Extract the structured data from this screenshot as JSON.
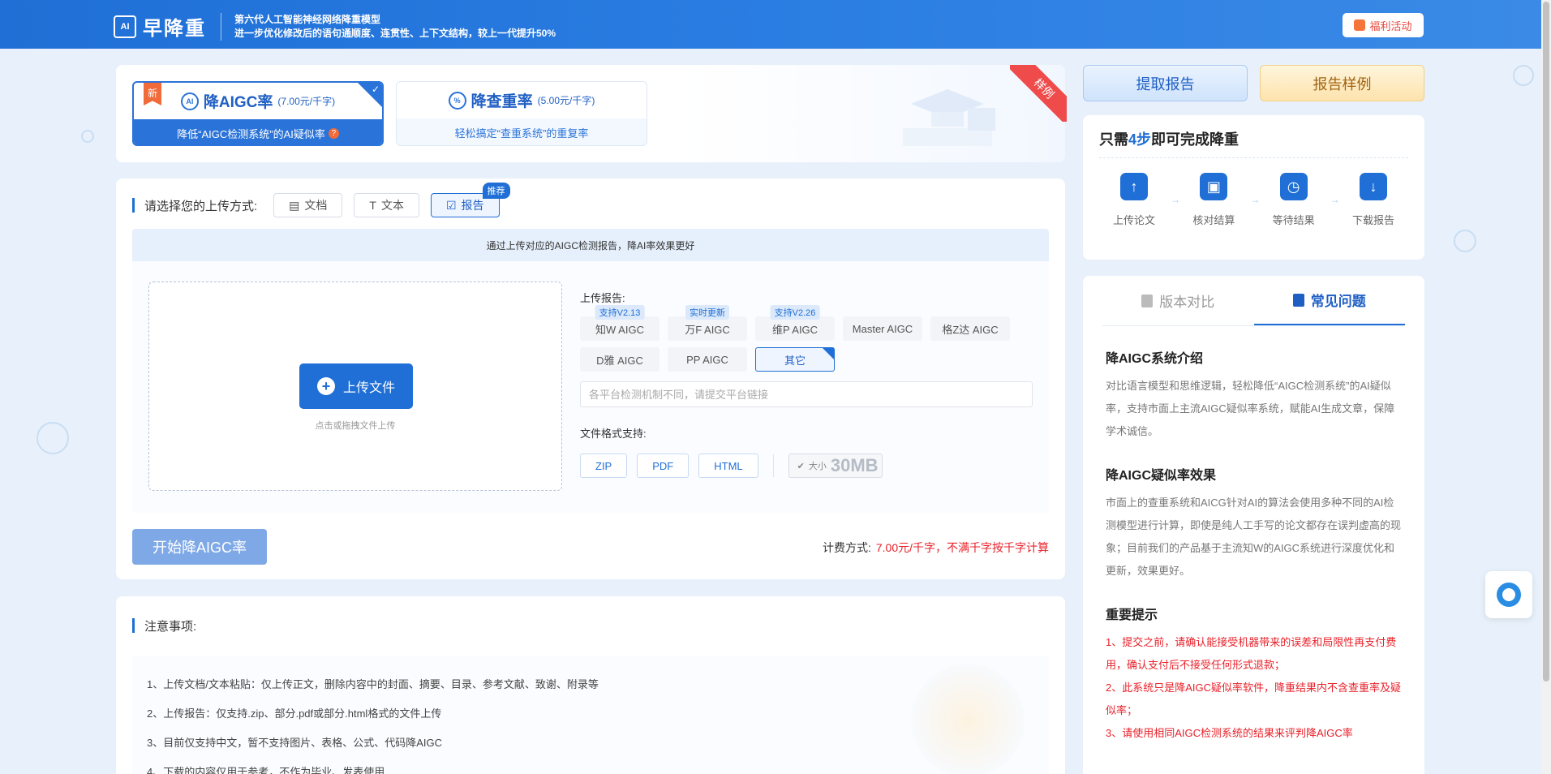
{
  "header": {
    "logo_mark": "AI",
    "logo_text": "早降重",
    "tagline_line1": "第六代人工智能神经网络降重模型",
    "tagline_line2": "进一步优化修改后的语句通顺度、连贯性、上下文结构，较上一代提升50%",
    "promo_label": "福利活动"
  },
  "modes": {
    "aigc": {
      "badge": "新",
      "icon": "AI",
      "title": "降AIGC率",
      "price": "(7.00元/千字)",
      "desc": "降低“AIGC检测系统”的AI疑似率",
      "help_icon": "?"
    },
    "dup": {
      "icon": "%",
      "title": "降查重率",
      "price": "(5.00元/千字)",
      "desc": "轻松搞定“查重系统”的重复率"
    },
    "sample_ribbon": "样例"
  },
  "actions": {
    "extract_report": "提取报告",
    "report_sample": "报告样例"
  },
  "steps": {
    "title_prefix": "只需",
    "title_highlight": "4步",
    "title_suffix": "即可完成降重",
    "items": [
      {
        "label": "上传论文",
        "icon": "upload-icon"
      },
      {
        "label": "核对结算",
        "icon": "wallet-icon"
      },
      {
        "label": "等待结果",
        "icon": "clock-icon"
      },
      {
        "label": "下载报告",
        "icon": "download-icon"
      }
    ]
  },
  "faq": {
    "tabs": [
      "版本对比",
      "常见问题"
    ],
    "active_tab": "常见问题",
    "sections": [
      {
        "heading": "降AIGC系统介绍",
        "body": "对比语言模型和思维逻辑，轻松降低“AIGC检测系统”的AI疑似率，支持市面上主流AIGC疑似率系统，赋能AI生成文章，保障学术诚信。"
      },
      {
        "heading": "降AIGC疑似率效果",
        "body": "市面上的查重系统和AICG针对AI的算法会使用多种不同的AI检测模型进行计算，即使是纯人工手写的论文都存在误判虚高的现象；目前我们的产品基于主流知W的AIGC系统进行深度优化和更新，效果更好。"
      }
    ],
    "tips_heading": "重要提示",
    "tips": [
      "1、提交之前，请确认能接受机器带来的误差和局限性再支付费用，确认支付后不接受任何形式退款；",
      "2、此系统只是降AIGC疑似率软件，降重结果内不含查重率及疑似率；",
      "3、请使用相同AIGC检测系统的结果来评判降AIGC率"
    ]
  },
  "upload": {
    "method_label": "请选择您的上传方式:",
    "methods": [
      "文档",
      "文本",
      "报告"
    ],
    "active_method": "报告",
    "recommend_badge": "推荐",
    "hint": "通过上传对应的AIGC检测报告，降AI率效果更好",
    "upload_button": "上传文件",
    "drop_hint": "点击或拖拽文件上传",
    "report_label": "上传报告:",
    "platforms": [
      {
        "name": "知W AIGC",
        "tag": "支持V2.13"
      },
      {
        "name": "万F AIGC",
        "tag": "实时更新"
      },
      {
        "name": "维P AIGC",
        "tag": "支持V2.26"
      },
      {
        "name": "Master AIGC",
        "tag": ""
      },
      {
        "name": "格Z达 AIGC",
        "tag": ""
      },
      {
        "name": "D雅 AIGC",
        "tag": ""
      },
      {
        "name": "PP AIGC",
        "tag": ""
      },
      {
        "name": "其它",
        "tag": ""
      }
    ],
    "active_platform": "其它",
    "link_placeholder": "各平台检测机制不同，请提交平台链接",
    "format_label": "文件格式支持:",
    "formats": [
      "ZIP",
      "PDF",
      "HTML"
    ],
    "size_small": "大小",
    "size_value": "30MB",
    "start_button": "开始降AIGC率",
    "pricing_label": "计费方式:",
    "pricing_value": "7.00元/千字，不满千字按千字计算"
  },
  "notes": {
    "title": "注意事项:",
    "items": [
      "1、上传文档/文本粘贴：仅上传正文，删除内容中的封面、摘要、目录、参考文献、致谢、附录等",
      "2、上传报告：仅支持.zip、部分.pdf或部分.html格式的文件上传",
      "3、目前仅支持中文，暂不支持图片、表格、公式、代码降AIGC",
      "4、下载的内容仅用于参考，不作为毕业、发表使用"
    ]
  },
  "colors": {
    "primary": "#1f6fd6",
    "danger": "#e8212a",
    "background": "#e8f1fb"
  }
}
